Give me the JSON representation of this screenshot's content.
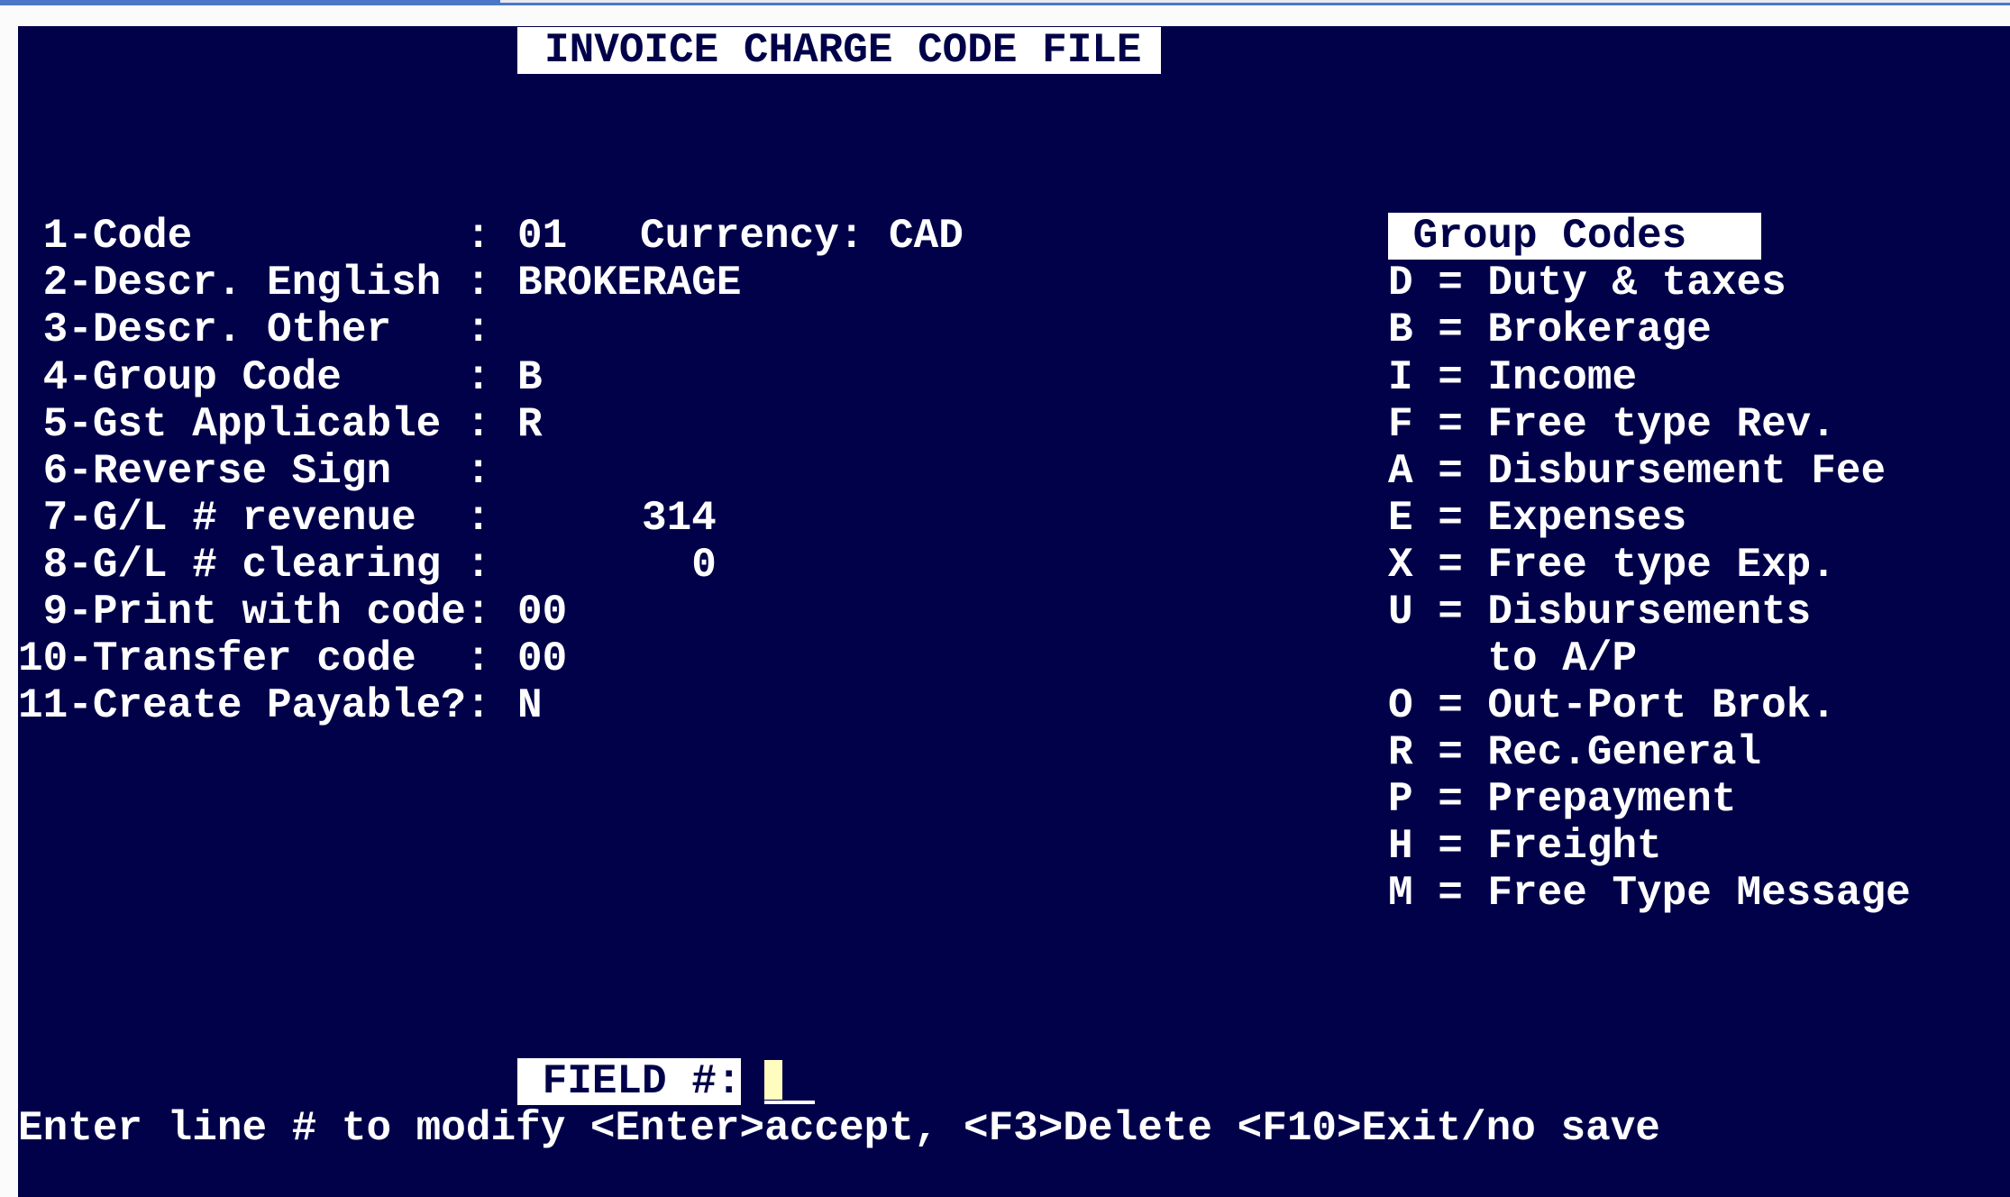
{
  "title": "INVOICE CHARGE CODE FILE",
  "fields": [
    {
      "label": " 1-Code           : ",
      "value": "01"
    },
    {
      "label": " 2-Descr. English : ",
      "value": "BROKERAGE"
    },
    {
      "label": " 3-Descr. Other   : ",
      "value": ""
    },
    {
      "label": " 4-Group Code     : ",
      "value": "B"
    },
    {
      "label": " 5-Gst Applicable : ",
      "value": "R"
    },
    {
      "label": " 6-Reverse Sign   : ",
      "value": ""
    },
    {
      "label": " 7-G/L # revenue  : ",
      "value": "     314"
    },
    {
      "label": " 8-G/L # clearing : ",
      "value": "       0"
    },
    {
      "label": " 9-Print with code: ",
      "value": "00"
    },
    {
      "label": "10-Transfer code  : ",
      "value": "00"
    },
    {
      "label": "11-Create Payable?: ",
      "value": "N"
    }
  ],
  "currency": {
    "label": "Currency:",
    "value": "CAD"
  },
  "group_codes": {
    "title": " Group Codes   ",
    "items": [
      "D = Duty & taxes",
      "B = Brokerage",
      "I = Income",
      "F = Free type Rev.",
      "A = Disbursement Fee",
      "E = Expenses",
      "X = Free type Exp.",
      "U = Disbursements",
      "    to A/P",
      "O = Out-Port Brok.",
      "R = Rec.General",
      "P = Prepayment",
      "H = Freight",
      "M = Free Type Message"
    ]
  },
  "prompt": {
    "label": " FIELD #: ",
    "value": ""
  },
  "help_line": "Enter line # to modify <Enter>accept, <F3>Delete <F10>Exit/no save",
  "colors": {
    "screen_bg": "#01014a",
    "text": "#ffffff",
    "cursor": "#fffcbf"
  }
}
